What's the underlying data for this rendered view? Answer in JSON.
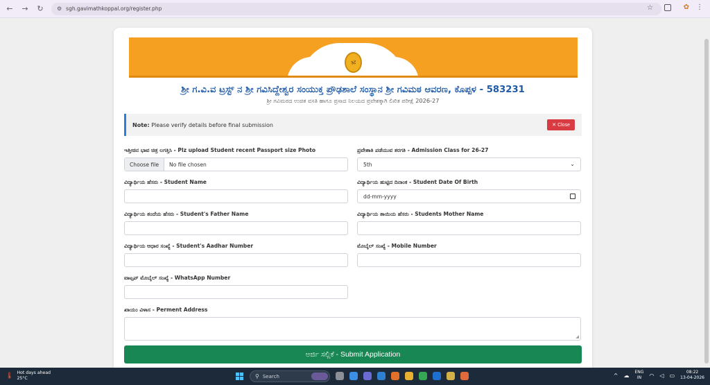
{
  "browser": {
    "url": "sgh.gavimathkoppal.org/register.php"
  },
  "header": {
    "title": "ಶ್ರೀ ಗ.ವಿ.ವ ಟ್ರಸ್ಟ್ ನ ಶ್ರೀ ಗವಿಸಿದ್ದೇಶ್ವರ ಸಂಯುಕ್ತ ಪ್ರೌಢಶಾಲೆ ಸಂಸ್ಥಾನ ಶ್ರೀ ಗವಿಮಠ ಆವರಣ, ಕೊಪ್ಪಳ - 583231",
    "subtitle": "ಶ್ರೀ ಗವಿಮಠದ ಉಚಿತ ವಸತಿ ಹಾಗೂ ಪ್ರಸಾದ ನಿಲಯದ ಪ್ರವೇಶಕ್ಕಾಗಿ ಲಿಖಿತ ಪರೀಕ್ಷೆ 2026-27"
  },
  "alert": {
    "strong": "Note:",
    "text": "Please verify details before final submission",
    "close_label": "✕ Close"
  },
  "form": {
    "photo_label": "ಇತ್ತೀಚಿನ ಭಾವ ಚಿತ್ರ ಲಗತ್ತಿಸಿ - Plz upload Student recent Passport size Photo",
    "choose_file": "Choose file",
    "no_file": "No file chosen",
    "class_label": "ಪ್ರವೇಶಾತಿ ಪಡೆಯುವ ತರಗತಿ - Admission Class for 26-27",
    "class_value": "5th",
    "name_label": "ವಿದ್ಯಾರ್ಥಿಯ ಹೆಸರು - Student Name",
    "dob_label": "ವಿದ್ಯಾರ್ಥಿಯ ಹುಟ್ಟಿದ ದಿನಾಂಕ - Student Date Of Birth",
    "dob_placeholder": "dd-mm-yyyy",
    "father_label": "ವಿದ್ಯಾರ್ಥಿಯ ತಂದೆಯ ಹೆಸರು - Student's Father Name",
    "mother_label": "ವಿದ್ಯಾರ್ಥಿಯ ತಾಯಿಯ ಹೆಸರು - Students Mother Name",
    "aadhar_label": "ವಿದ್ಯಾರ್ಥಿಯ ಆಧಾರ ಸಂಖ್ಯೆ - Student's Aadhar Number",
    "mobile_label": "ಮೊಬೈಲ್ ಸಂಖ್ಯೆ - Mobile Number",
    "whatsapp_label": "ವಾಟ್ಸಪ್ ಮೊಬೈಲ್ ಸಂಖ್ಯೆ - WhatsApp Number",
    "address_label": "ಖಾಯಂ ವಿಳಾಸ - Perment Address",
    "submit_label": "ಅರ್ಜಿ ಸಲ್ಲಿಕೆ - Submit Application"
  },
  "taskbar": {
    "weather_title": "Hot days ahead",
    "weather_temp": "25°C",
    "search_text": "Search",
    "lang_top": "ENG",
    "lang_bottom": "IN",
    "time": "08:22",
    "date": "13-04-2026"
  },
  "colors": {
    "brand_orange": "#f5a021",
    "title_blue": "#1f5aa6",
    "submit_green": "#198754",
    "close_red": "#d93b42"
  }
}
